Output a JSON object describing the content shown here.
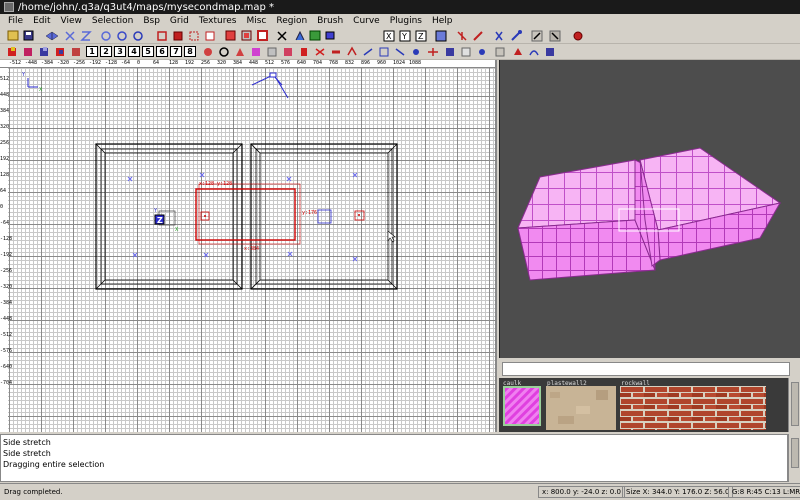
{
  "window": {
    "title": "/home/john/.q3a/q3ut4/maps/mysecondmap.map *"
  },
  "menu": [
    "File",
    "Edit",
    "View",
    "Selection",
    "Bsp",
    "Grid",
    "Textures",
    "Misc",
    "Region",
    "Brush",
    "Curve",
    "Plugins",
    "Help"
  ],
  "toolbar2": {
    "number_buttons": [
      "1",
      "2",
      "3",
      "4",
      "5",
      "6",
      "7",
      "8"
    ]
  },
  "grid2d": {
    "ruler_x": [
      "-512",
      "-448",
      "-384",
      "-320",
      "-256",
      "-192",
      "-128",
      "-64",
      "0",
      "64",
      "128",
      "192",
      "256",
      "320",
      "384",
      "448",
      "512",
      "576",
      "640",
      "704",
      "768",
      "832",
      "896",
      "960",
      "1024",
      "1088"
    ],
    "ruler_y": [
      "512",
      "448",
      "384",
      "320",
      "256",
      "192",
      "128",
      "64",
      "0",
      "-64",
      "-128",
      "-192",
      "-256",
      "-320",
      "-384",
      "-448",
      "-512",
      "-576",
      "-640",
      "-704"
    ],
    "axis_y_label": "Y",
    "axis_x_label": "X",
    "z_marker_label": "Z",
    "sel_label_top": "x:128  y:128",
    "sel_label_right": "y:176",
    "sel_label_bottom": "x:384"
  },
  "texbrowser": {
    "filter_value": "",
    "textures": [
      {
        "name": "caulk",
        "selected": true
      },
      {
        "name": "plastewall2",
        "selected": false
      },
      {
        "name": "rockwall",
        "selected": false
      }
    ]
  },
  "console": {
    "lines": [
      "Side stretch",
      "Side stretch",
      "Dragging entire selection"
    ]
  },
  "status": {
    "message": "Drag completed.",
    "coords": "x: 800.0  y: -24.0  z: 0.0",
    "size": "Size X: 344.0  Y: 176.0  Z: 56.0",
    "grid": "G:8 R:45 C:13 L:MR"
  }
}
